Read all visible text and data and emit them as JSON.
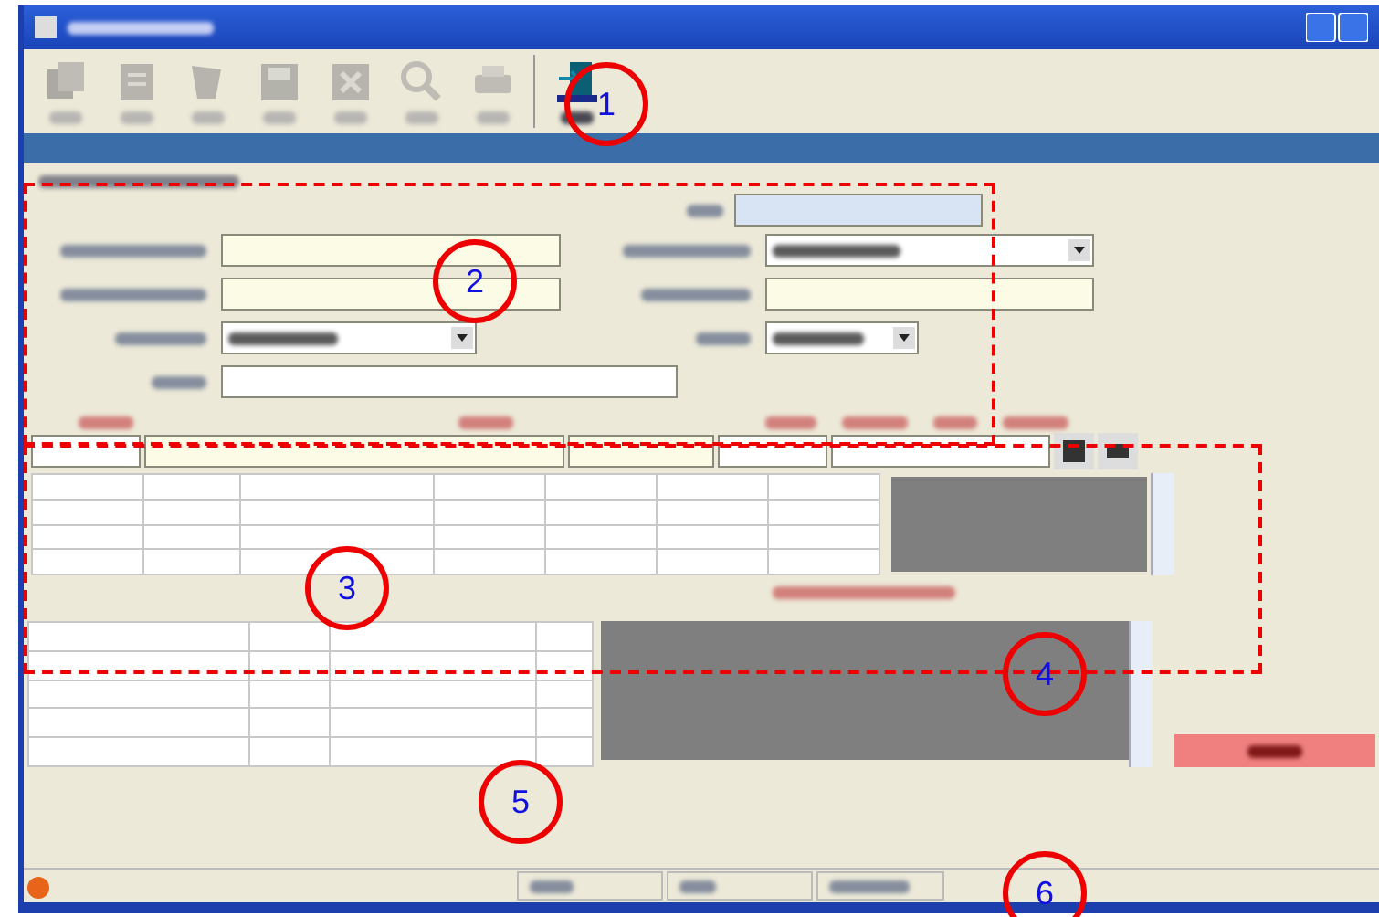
{
  "toolbar": {
    "buttons": [
      {
        "kind": "copy",
        "disabled": true
      },
      {
        "kind": "edit",
        "disabled": true
      },
      {
        "kind": "delete",
        "disabled": true
      },
      {
        "kind": "save",
        "disabled": true
      },
      {
        "kind": "cancel",
        "disabled": true
      },
      {
        "kind": "search",
        "disabled": true
      },
      {
        "kind": "print",
        "disabled": true
      },
      {
        "kind": "exit",
        "disabled": false
      }
    ]
  },
  "annotations": [
    {
      "number": "1"
    },
    {
      "number": "2"
    },
    {
      "number": "3"
    },
    {
      "number": "4"
    },
    {
      "number": "5"
    },
    {
      "number": "6"
    }
  ]
}
